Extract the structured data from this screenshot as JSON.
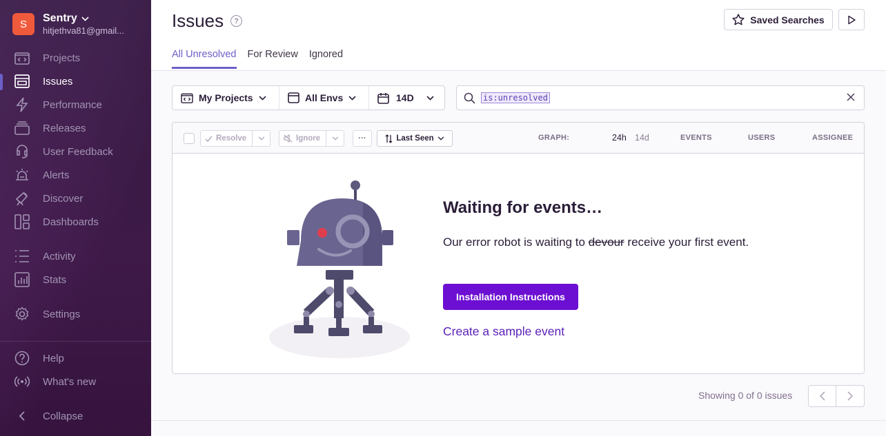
{
  "org": {
    "avatar_letter": "S",
    "name": "Sentry",
    "email": "hitjethva81@gmail...",
    "avatar_color": "#f05a3c"
  },
  "sidebar": {
    "items": [
      {
        "label": "Projects",
        "icon": "projects-icon"
      },
      {
        "label": "Issues",
        "icon": "issues-icon",
        "active": true
      },
      {
        "label": "Performance",
        "icon": "performance-icon"
      },
      {
        "label": "Releases",
        "icon": "releases-icon"
      },
      {
        "label": "User Feedback",
        "icon": "user-feedback-icon"
      },
      {
        "label": "Alerts",
        "icon": "alerts-icon"
      },
      {
        "label": "Discover",
        "icon": "discover-icon"
      },
      {
        "label": "Dashboards",
        "icon": "dashboards-icon"
      },
      {
        "label": "Activity",
        "icon": "activity-icon"
      },
      {
        "label": "Stats",
        "icon": "stats-icon"
      },
      {
        "label": "Settings",
        "icon": "settings-icon"
      }
    ],
    "bottom": [
      {
        "label": "Help",
        "icon": "help-icon"
      },
      {
        "label": "What's new",
        "icon": "broadcast-icon"
      },
      {
        "label": "Collapse",
        "icon": "collapse-icon"
      }
    ]
  },
  "header": {
    "title": "Issues",
    "saved_searches": "Saved Searches",
    "tabs": [
      "All Unresolved",
      "For Review",
      "Ignored"
    ]
  },
  "filters": {
    "projects": "My Projects",
    "envs": "All Envs",
    "period": "14D"
  },
  "search": {
    "query": "is:unresolved"
  },
  "toolbar": {
    "resolve": "Resolve",
    "ignore": "Ignore",
    "more": "···",
    "sort": "Last Seen",
    "graph_label": "GRAPH:",
    "graph_24h": "24h",
    "graph_14d": "14d",
    "events": "EVENTS",
    "users": "USERS",
    "assignee": "ASSIGNEE"
  },
  "empty": {
    "title": "Waiting for events…",
    "desc_before": "Our error robot is waiting to ",
    "desc_struck": "devour",
    "desc_after": " receive your first event.",
    "install_button": "Installation Instructions",
    "sample_link": "Create a sample event"
  },
  "pagination": {
    "showing": "Showing 0 of 0 issues"
  },
  "colors": {
    "accent": "#6c5fc7",
    "primary_button": "#6c0fd2",
    "link": "#5a1fb8"
  }
}
